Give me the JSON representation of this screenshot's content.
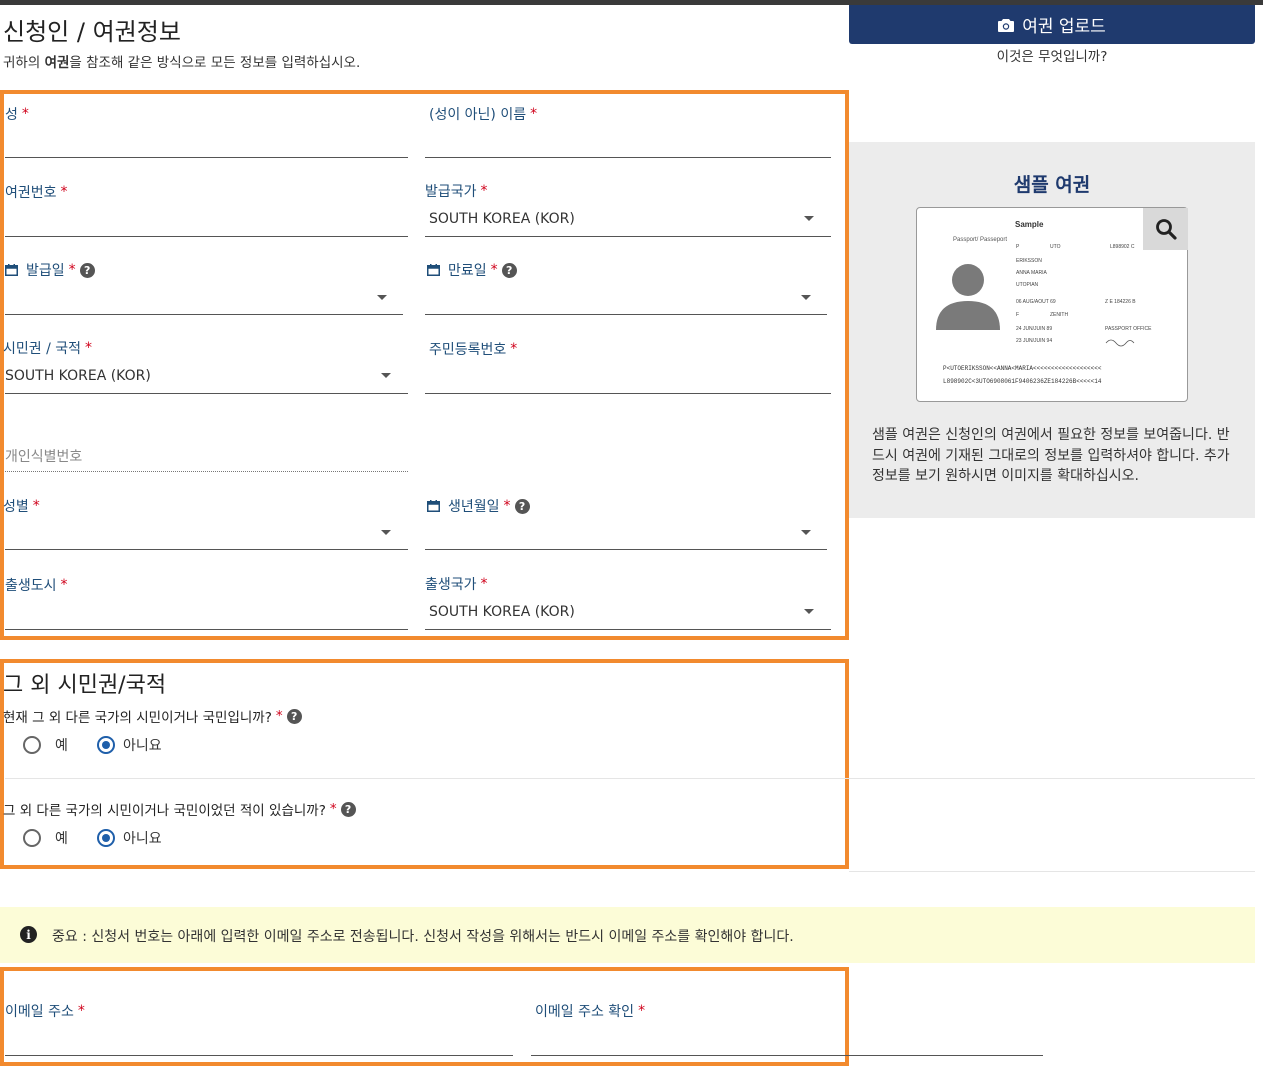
{
  "header": {
    "title": "신청인 / 여권정보",
    "subtitle_pre": "귀하의 ",
    "subtitle_bold": "여권",
    "subtitle_post": "을 참조해 같은 방식으로 모든 정보를 입력하십시오.",
    "upload_label": "여권 업로드",
    "whatis_label": "이것은 무엇입니까?"
  },
  "required_mark": "*",
  "help_mark": "?",
  "fields": {
    "surname": {
      "label": "성",
      "value": ""
    },
    "given_name": {
      "label": "(성이 아닌) 이름",
      "value": ""
    },
    "passport_number": {
      "label": "여권번호",
      "value": ""
    },
    "issuing_country": {
      "label": "발급국가",
      "value": "SOUTH KOREA (KOR)"
    },
    "issue_date": {
      "label": "발급일",
      "value": ""
    },
    "expiry_date": {
      "label": "만료일",
      "value": ""
    },
    "citizenship": {
      "label": "시민권 / 국적",
      "value": "SOUTH KOREA (KOR)"
    },
    "resident_number": {
      "label": "주민등록번호",
      "value": ""
    },
    "personal_id": {
      "label": "개인식별번호",
      "value": ""
    },
    "sex": {
      "label": "성별",
      "value": ""
    },
    "birth_date": {
      "label": "생년월일",
      "value": ""
    },
    "birth_city": {
      "label": "출생도시",
      "value": ""
    },
    "birth_country": {
      "label": "출생국가",
      "value": "SOUTH KOREA (KOR)"
    }
  },
  "sample": {
    "title": "샘플 여권",
    "description": "샘플 여권은 신청인의 여권에서 필요한 정보를 보여줍니다. 반드시 여권에 기재된 그대로의 정보를 입력하셔야 합니다. 추가 정보를 보기 원하시면 이미지를 확대하십시오.",
    "passport": {
      "heading": "Sample",
      "side_label": "Passport/ Passeport",
      "type": "P",
      "country_code": "UTO",
      "passport_no": "L898902 C",
      "surname": "ERIKSSON",
      "given_names": "ANNA MARIA",
      "nationality": "UTOPIAN",
      "dob": "06 AUG/AOUT 69",
      "personal_no": "Z E 184226 B",
      "sex": "F",
      "pob": "ZENITH",
      "doi": "24 JUN/JUIN 89",
      "authority": "PASSPORT OFFICE",
      "doe": "23 JUN/JUIN 94",
      "mrz1": "P<UTOERIKSSON<<ANNA<MARIA<<<<<<<<<<<<<<<<<<<",
      "mrz2": "L898902C<3UTO6908061F9406236ZE184226B<<<<<14"
    }
  },
  "other_citizenship": {
    "title": "그 외 시민권/국적",
    "q1": "현재 그 외 다른 국가의 시민이거나 국민입니까?",
    "q2": "그 외 다른 국가의 시민이거나 국민이었던 적이 있습니까?",
    "yes": "예",
    "no": "아니요",
    "q1_answer": "no",
    "q2_answer": "no"
  },
  "notice": {
    "text": "중요 : 신청서 번호는 아래에 입력한 이메일 주소로 전송됩니다. 신청서 작성을 위해서는 반드시 이메일 주소를 확인해야 합니다."
  },
  "email": {
    "email_label": "이메일 주소",
    "confirm_label": "이메일 주소 확인"
  },
  "colors": {
    "highlight": "#f28a2e",
    "primary": "#1f3a6e",
    "label": "#1f4e79",
    "required": "#d0021b",
    "notice_bg": "#fcfcd7"
  }
}
